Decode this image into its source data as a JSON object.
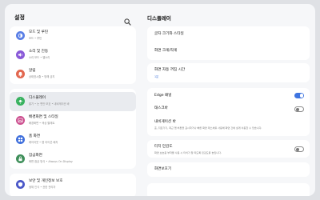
{
  "left": {
    "title": "설정",
    "items": [
      {
        "title": "모드 및 루틴",
        "sub": "모드 • 루틴",
        "color": "#5a7fe6"
      },
      {
        "title": "소리 및 진동",
        "sub": "소리 모드 • 벨소리",
        "color": "#8a5ad8"
      },
      {
        "title": "알림",
        "sub": "상태표시줄 • 방해 금지",
        "color": "#e2674f"
      },
      {
        "title": "디스플레이",
        "sub": "밝기 • 눈 편안 보호 • 내비게이션 바",
        "color": "#38b15e"
      },
      {
        "title": "배경화면 및 스타일",
        "sub": "배경화면 • 색상 팔레트",
        "color": "#cc4f8f"
      },
      {
        "title": "홈 화면",
        "sub": "레이아웃 • 앱 아이콘 배지",
        "color": "#3f6fdc"
      },
      {
        "title": "잠금화면",
        "sub": "화면 잠금 방식 • Always On Display",
        "color": "#3f8f5a"
      },
      {
        "title": "보안 및 개인정보 보호",
        "sub": "생체 인식 • 권한 관리자",
        "color": "#4a57c8"
      }
    ]
  },
  "right": {
    "title": "디스플레이",
    "rows": {
      "font": "글자 크기와 스타일",
      "zoom": "화면 크게/작게",
      "timeout": "화면 자동 꺼짐 시간",
      "timeout_val": "1분",
      "edge": "Edge 패널",
      "taskbar": "태스크바",
      "navbar": "내비게이션 바",
      "navbar_sub": "홈, 뒤로가기, 최근 앱 버튼을 표시하거나 빠른 화면 제스처를 사용해 화면 간에 쉽게 이동할 수 있습니다.",
      "touch": "터치 민감도",
      "touch_sub": "화면 보호용 부착물 사용 시 터치가 잘 되도록 민감도를 높입니다.",
      "screensaver": "화면보호기"
    },
    "toggles": {
      "edge": true,
      "taskbar": false,
      "touch": false
    }
  },
  "colors": {
    "accent": "#3e74e0"
  }
}
